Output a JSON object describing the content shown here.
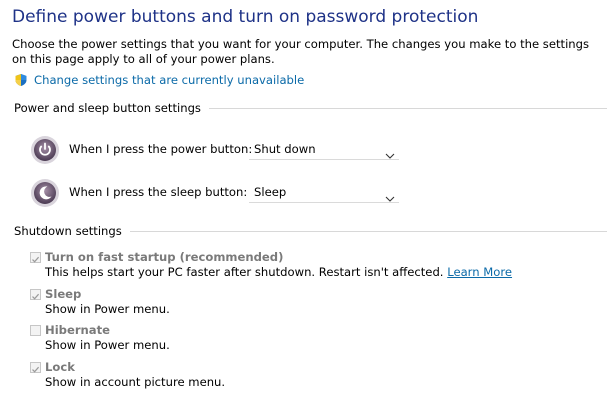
{
  "title": "Define power buttons and turn on password protection",
  "intro": "Choose the power settings that you want for your computer. The changes you make to the settings on this page apply to all of your power plans.",
  "change_link": "Change settings that are currently unavailable",
  "power_sleep": {
    "heading": "Power and sleep button settings",
    "power_button": {
      "label": "When I press the power button:",
      "value": "Shut down",
      "icon": "power-icon"
    },
    "sleep_button": {
      "label": "When I press the sleep button:",
      "value": "Sleep",
      "icon": "sleep-moon-icon"
    }
  },
  "shutdown": {
    "heading": "Shutdown settings",
    "options": [
      {
        "label": "Turn on fast startup (recommended)",
        "desc": "This helps start your PC faster after shutdown. Restart isn't affected.",
        "link": "Learn More",
        "checked": true
      },
      {
        "label": "Sleep",
        "desc": "Show in Power menu.",
        "checked": true
      },
      {
        "label": "Hibernate",
        "desc": "Show in Power menu.",
        "checked": false
      },
      {
        "label": "Lock",
        "desc": "Show in account picture menu.",
        "checked": true
      }
    ]
  },
  "colors": {
    "title": "#1e3287",
    "link": "#0b6aa8",
    "disabled_label": "#7a7a7a"
  }
}
